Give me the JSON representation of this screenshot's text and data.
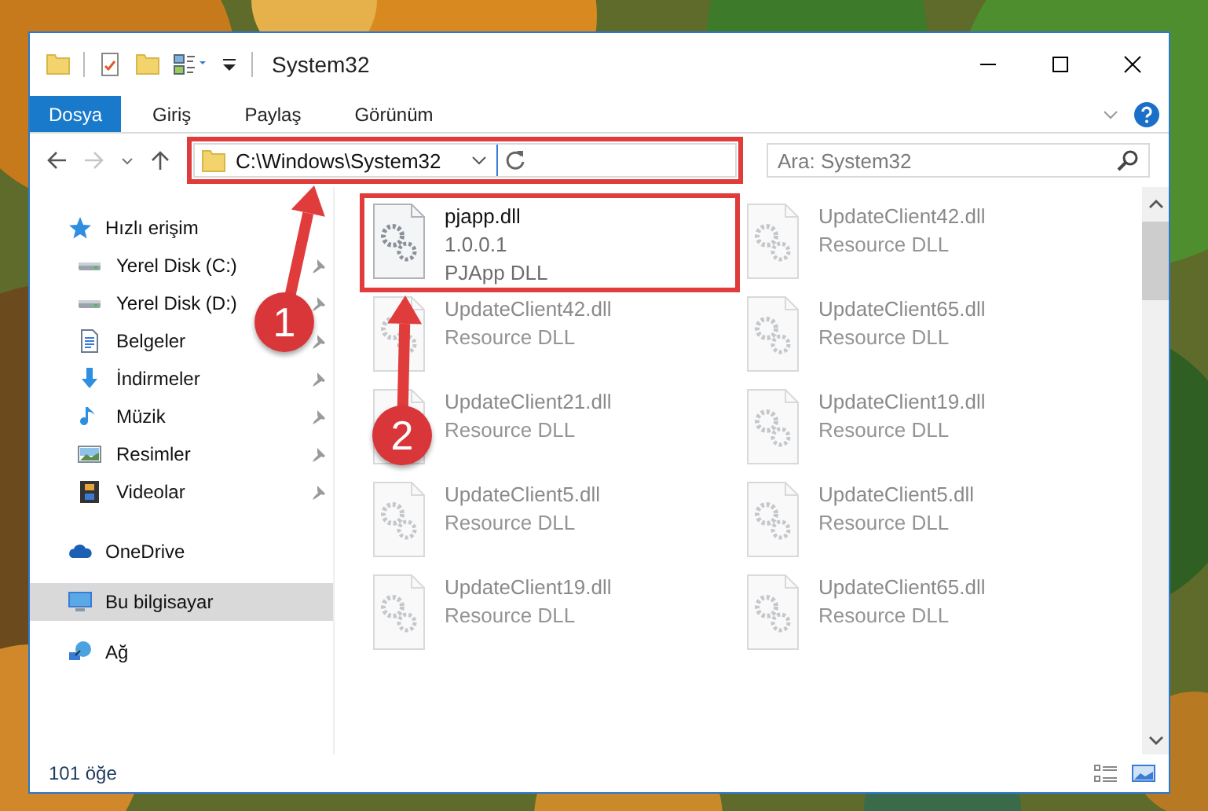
{
  "window": {
    "title": "System32"
  },
  "ribbon_tabs": [
    {
      "label": "Dosya",
      "selected": true
    },
    {
      "label": "Giriş",
      "selected": false
    },
    {
      "label": "Paylaş",
      "selected": false
    },
    {
      "label": "Görünüm",
      "selected": false
    }
  ],
  "address": {
    "value": "C:\\Windows\\System32",
    "highlighted": true
  },
  "search": {
    "placeholder": "Ara: System32"
  },
  "sidebar": {
    "items": [
      {
        "label": "Hızlı erişim",
        "selected": false,
        "children": [
          {
            "label": "Yerel Disk (C:)",
            "pinned": true
          },
          {
            "label": "Yerel Disk (D:)",
            "pinned": true
          },
          {
            "label": "Belgeler",
            "pinned": true
          },
          {
            "label": "İndirmeler",
            "pinned": true
          },
          {
            "label": "Müzik",
            "pinned": true
          },
          {
            "label": "Resimler",
            "pinned": true
          },
          {
            "label": "Videolar",
            "pinned": true
          }
        ]
      },
      {
        "label": "OneDrive",
        "selected": false
      },
      {
        "label": "Bu bilgisayar",
        "selected": true
      },
      {
        "label": "Ağ",
        "selected": false
      }
    ]
  },
  "files": [
    {
      "name": "pjapp.dll",
      "lines": [
        "1.0.0.1",
        "PJApp DLL"
      ],
      "blurred": false,
      "highlighted": true
    },
    {
      "name": "UpdateClient42.dll",
      "lines": [
        "Resource DLL"
      ],
      "blurred": true,
      "highlighted": false
    },
    {
      "name": "UpdateClient42.dll",
      "lines": [
        "Resource DLL"
      ],
      "blurred": true,
      "highlighted": false
    },
    {
      "name": "UpdateClient65.dll",
      "lines": [
        "Resource DLL"
      ],
      "blurred": true,
      "highlighted": false
    },
    {
      "name": "UpdateClient21.dll",
      "lines": [
        "Resource DLL"
      ],
      "blurred": true,
      "highlighted": false
    },
    {
      "name": "UpdateClient19.dll",
      "lines": [
        "Resource DLL"
      ],
      "blurred": true,
      "highlighted": false
    },
    {
      "name": "UpdateClient5.dll",
      "lines": [
        "Resource DLL"
      ],
      "blurred": true,
      "highlighted": false
    },
    {
      "name": "UpdateClient5.dll",
      "lines": [
        "Resource DLL"
      ],
      "blurred": true,
      "highlighted": false
    },
    {
      "name": "UpdateClient19.dll",
      "lines": [
        "Resource DLL"
      ],
      "blurred": true,
      "highlighted": false
    },
    {
      "name": "UpdateClient65.dll",
      "lines": [
        "Resource DLL"
      ],
      "blurred": true,
      "highlighted": false
    }
  ],
  "status_bar": {
    "count": "101 öğe"
  },
  "annotations": [
    {
      "label": "1"
    },
    {
      "label": "2"
    }
  ]
}
